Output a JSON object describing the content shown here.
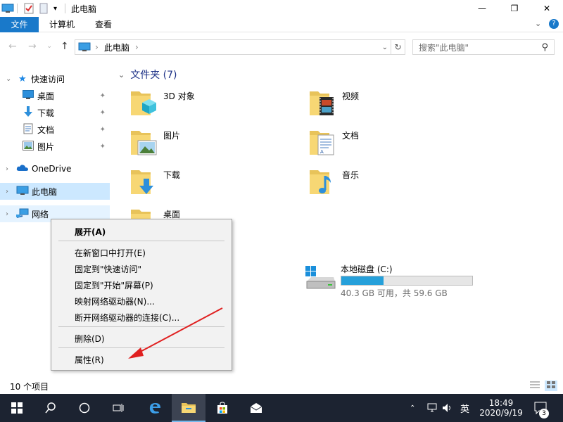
{
  "window": {
    "title": "此电脑",
    "qa_dropdown": "▾",
    "min": "—",
    "max": "❐",
    "close": "✕"
  },
  "ribbon": {
    "tabs": [
      "文件",
      "计算机",
      "查看"
    ],
    "collapse": "⌄",
    "help": "?"
  },
  "address": {
    "back": "←",
    "forward": "→",
    "recent": "⌄",
    "up": "↑",
    "path": "此电脑",
    "sep": "›",
    "dropdown": "⌄",
    "refresh": "↻",
    "search_placeholder": "搜索\"此电脑\"",
    "search_icon": "⚲"
  },
  "nav": {
    "quick_access": "快速访问",
    "items": [
      {
        "label": "桌面",
        "icon": "desktop-icon",
        "pinned": true
      },
      {
        "label": "下载",
        "icon": "download-icon",
        "pinned": true
      },
      {
        "label": "文档",
        "icon": "document-icon",
        "pinned": true
      },
      {
        "label": "图片",
        "icon": "pictures-icon",
        "pinned": true
      }
    ],
    "onedrive": "OneDrive",
    "this_pc": "此电脑",
    "network": "网络",
    "pin_glyph": "📌"
  },
  "content": {
    "folders_header": "文件夹 (7)",
    "folders": [
      {
        "label": "3D 对象",
        "icon": "3d-objects-icon"
      },
      {
        "label": "视频",
        "icon": "videos-icon"
      },
      {
        "label": "图片",
        "icon": "pictures-icon"
      },
      {
        "label": "文档",
        "icon": "documents-icon"
      },
      {
        "label": "下载",
        "icon": "downloads-icon"
      },
      {
        "label": "音乐",
        "icon": "music-icon"
      },
      {
        "label": "桌面",
        "icon": "desktop-folder-icon"
      }
    ],
    "drive": {
      "label": "本地磁盘 (C:)",
      "space": "40.3 GB 可用，共 59.6 GB",
      "used_fraction": 0.324
    }
  },
  "statusbar": {
    "count": "10 个项目"
  },
  "context_menu": {
    "items": [
      {
        "label": "展开(A)",
        "bold": true
      },
      {
        "label": "在新窗口中打开(E)"
      },
      {
        "label": "固定到\"快速访问\""
      },
      {
        "label": "固定到\"开始\"屏幕(P)"
      },
      {
        "label": "映射网络驱动器(N)..."
      },
      {
        "label": "断开网络驱动器的连接(C)..."
      },
      {
        "label": "删除(D)"
      },
      {
        "label": "属性(R)"
      }
    ]
  },
  "taskbar": {
    "time": "18:49",
    "date": "2020/9/19",
    "ime": "英",
    "notifications": "3",
    "tray_chevron": "⌃"
  },
  "colors": {
    "accent": "#1979ca",
    "selection": "#cce8ff",
    "taskbar": "#1c2331",
    "drive_bar": "#26a0da",
    "arrow": "#e02020"
  }
}
